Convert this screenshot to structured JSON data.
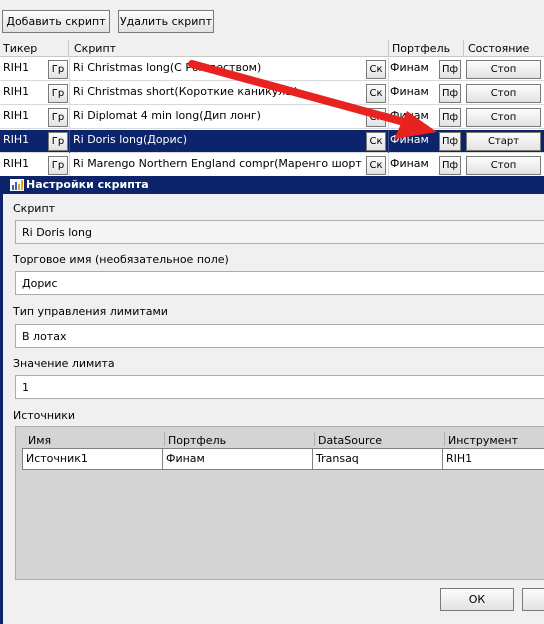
{
  "toolbar": {
    "add_label": "Добавить скрипт",
    "remove_label": "Удалить скрипт"
  },
  "grid": {
    "headers": {
      "ticker": "Тикер",
      "script": "Скрипт",
      "portfolio": "Портфель",
      "state": "Состояние"
    },
    "rows": [
      {
        "ticker": "RIH1",
        "gr": "Гр",
        "script": "Ri Christmas long(С Рождеством)",
        "sk": "Ск",
        "portfolio": "Финам",
        "pf": "Пф",
        "state": "Стоп"
      },
      {
        "ticker": "RIH1",
        "gr": "Гр",
        "script": "Ri Christmas short(Короткие каникулы)",
        "sk": "Ск",
        "portfolio": "Финам",
        "pf": "Пф",
        "state": "Стоп"
      },
      {
        "ticker": "RIH1",
        "gr": "Гр",
        "script": "Ri Diplomat 4 min long(Дип лонг)",
        "sk": "Ск",
        "portfolio": "Финам",
        "pf": "Пф",
        "state": "Стоп"
      },
      {
        "ticker": "RIH1",
        "gr": "Гр",
        "script": "Ri Doris long(Дорис)",
        "sk": "Ск",
        "portfolio": "Финам",
        "pf": "Пф",
        "state": "Старт"
      },
      {
        "ticker": "RIH1",
        "gr": "Гр",
        "script": "Ri Marengo Northern England compr(Маренго шорт на",
        "sk": "Ск",
        "portfolio": "Финам",
        "pf": "Пф",
        "state": "Стоп"
      }
    ],
    "selected_index": 3
  },
  "dialog": {
    "title": "Настройки скрипта",
    "script_label": "Скрипт",
    "script_value": "Ri Doris long",
    "trade_name_label": "Торговое имя (необязательное поле)",
    "trade_name_value": "Дорис",
    "limit_type_label": "Тип управления лимитами",
    "limit_type_value": "В лотах",
    "limit_value_label": "Значение лимита",
    "limit_value": "1",
    "sources_label": "Источники",
    "sources": {
      "headers": [
        "Имя",
        "Портфель",
        "DataSource",
        "Инструмент"
      ],
      "rows": [
        [
          "Источник1",
          "Финам",
          "Transaq",
          "RIH1"
        ]
      ]
    },
    "ok_label": "ОК"
  },
  "colors": {
    "selection": "#0b246b",
    "arrow": "#e8231f"
  }
}
